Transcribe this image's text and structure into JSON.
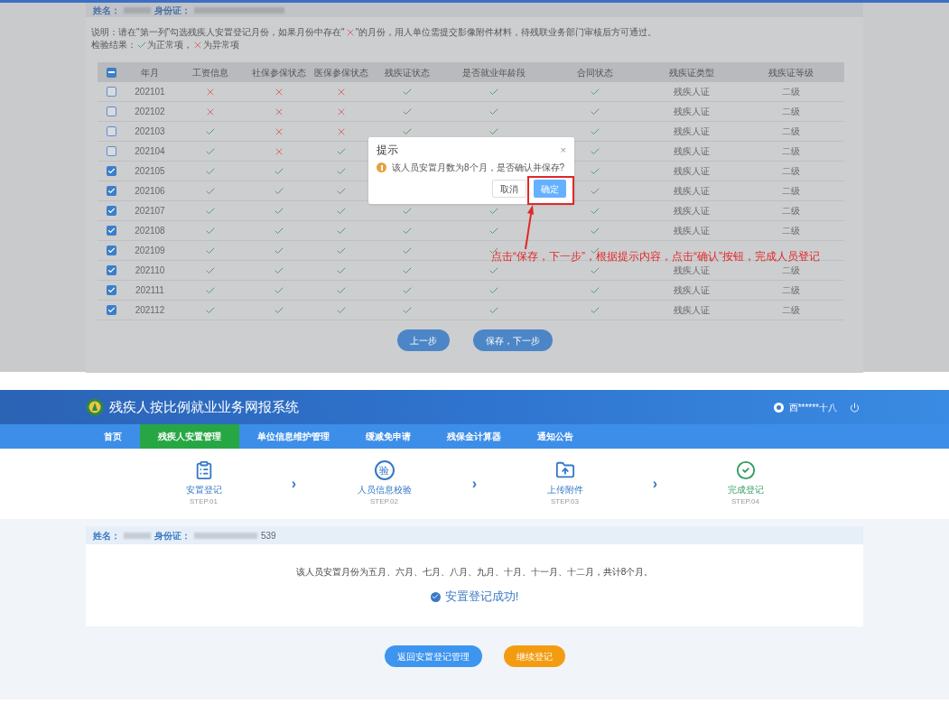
{
  "top_screen": {
    "name_bar": {
      "name_label": "姓名：",
      "id_label": "身份证："
    },
    "note": {
      "prefix": "说明：请在\"第一列\"勾选残疾人安置登记月份，如果月份中存在\"",
      "suffix": "\"的月份，用人单位需提交影像附件材料，待残联业务部门审核后方可通过。"
    },
    "legend": {
      "label": "检验结果：",
      "ok_text": "为正常项，",
      "bad_text": "为异常项"
    },
    "table": {
      "header_checkbox": {
        "indeterminate": true
      },
      "columns": [
        "年月",
        "工资信息",
        "社保参保状态",
        "医保参保状态",
        "残疾证状态",
        "是否就业年龄段",
        "合同状态",
        "残疾证类型",
        "残疾证等级"
      ],
      "rows": [
        {
          "checked": false,
          "month": "202101",
          "status": {
            "wage": false,
            "social": false,
            "medical": false,
            "cert": true,
            "age": true,
            "contract": true
          },
          "cert_type": "残疾人证",
          "cert_level": "二级"
        },
        {
          "checked": false,
          "month": "202102",
          "status": {
            "wage": false,
            "social": false,
            "medical": false,
            "cert": true,
            "age": true,
            "contract": true
          },
          "cert_type": "残疾人证",
          "cert_level": "二级"
        },
        {
          "checked": false,
          "month": "202103",
          "status": {
            "wage": true,
            "social": false,
            "medical": false,
            "cert": true,
            "age": true,
            "contract": true
          },
          "cert_type": "残疾人证",
          "cert_level": "二级"
        },
        {
          "checked": false,
          "month": "202104",
          "status": {
            "wage": true,
            "social": false,
            "medical": true,
            "contract": true
          },
          "cert_type": "残疾人证",
          "cert_level": "二级"
        },
        {
          "checked": true,
          "month": "202105",
          "status": {
            "wage": true,
            "social": true,
            "medical": true,
            "contract": true
          },
          "cert_type": "残疾人证",
          "cert_level": "二级"
        },
        {
          "checked": true,
          "month": "202106",
          "status": {
            "wage": true,
            "social": true,
            "medical": true,
            "contract": true
          },
          "cert_type": "残疾人证",
          "cert_level": "二级"
        },
        {
          "checked": true,
          "month": "202107",
          "status": {
            "wage": true,
            "social": true,
            "medical": true,
            "cert": true,
            "age": true,
            "contract": true
          },
          "cert_type": "残疾人证",
          "cert_level": "二级"
        },
        {
          "checked": true,
          "month": "202108",
          "status": {
            "wage": true,
            "social": true,
            "medical": true,
            "cert": true,
            "age": true,
            "contract": true
          },
          "cert_type": "残疾人证",
          "cert_level": "二级"
        },
        {
          "checked": true,
          "month": "202109",
          "status": {
            "wage": true,
            "social": true,
            "medical": true,
            "cert": true,
            "age": true,
            "contract": true
          }
        },
        {
          "checked": true,
          "month": "202110",
          "status": {
            "wage": true,
            "social": true,
            "medical": true,
            "cert": true,
            "age": true,
            "contract": true
          },
          "cert_type": "残疾人证",
          "cert_level": "二级"
        },
        {
          "checked": true,
          "month": "202111",
          "status": {
            "wage": true,
            "social": true,
            "medical": true,
            "cert": true,
            "age": true,
            "contract": true
          },
          "cert_type": "残疾人证",
          "cert_level": "二级"
        },
        {
          "checked": true,
          "month": "202112",
          "status": {
            "wage": true,
            "social": true,
            "medical": true,
            "cert": true,
            "age": true,
            "contract": true
          },
          "cert_type": "残疾人证",
          "cert_level": "二级"
        }
      ]
    },
    "buttons": [
      "上一步",
      "保存，下一步"
    ],
    "dialog": {
      "title": "提示",
      "close": "×",
      "message": "该人员安置月数为8个月，是否确认并保存?",
      "cancel": "取消",
      "confirm": "确定"
    },
    "annotation": "点击“保存，下一步”，根据提示内容，点击“确认”按钮，完成人员登记"
  },
  "bottom_screen": {
    "app_title": "残疾人按比例就业业务网报系统",
    "user": "西******十八",
    "nav": [
      {
        "label": "首页",
        "selected": false
      },
      {
        "label": "残疾人安置管理",
        "selected": true
      },
      {
        "label": "单位信息维护管理",
        "selected": false
      },
      {
        "label": "缓减免申请",
        "selected": false
      },
      {
        "label": "残保金计算器",
        "selected": false
      },
      {
        "label": "通知公告",
        "selected": false
      }
    ],
    "steps": [
      {
        "kind": "clipboard",
        "label": "安置登记",
        "step": "STEP.01",
        "selected": false
      },
      {
        "kind": "glyph",
        "glyph": "验",
        "label": "人员信息校验",
        "step": "STEP.02",
        "selected": false
      },
      {
        "kind": "upload",
        "label": "上传附件",
        "step": "STEP.03",
        "selected": false
      },
      {
        "kind": "check",
        "label": "完成登记",
        "step": "STEP.04",
        "selected": true
      }
    ],
    "step_separator": "›",
    "name_bar": {
      "name_label": "姓名：",
      "id_label": "身份证：",
      "id_tail": "539"
    },
    "summary": "该人员安置月份为五月、六月、七月、八月、九月、十月、十一月、十二月，共计8个月。",
    "success": "安置登记成功!",
    "buttons": [
      "返回安置登记管理",
      "继续登记"
    ]
  }
}
